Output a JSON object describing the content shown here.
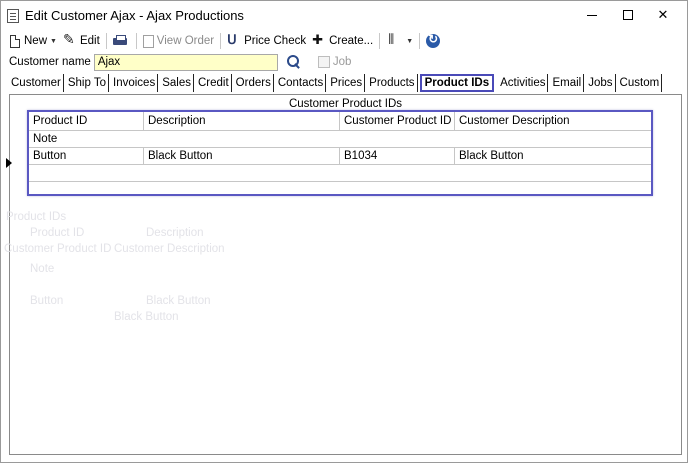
{
  "window": {
    "title": "Edit Customer Ajax - Ajax Productions"
  },
  "titlebar_buttons": {
    "close_glyph": "✕"
  },
  "toolbar": {
    "new_label": "New",
    "edit_label": "Edit",
    "view_order_label": "View Order",
    "price_check_label": "Price Check",
    "create_label": "Create..."
  },
  "customer": {
    "name_label": "Customer name",
    "name_value": "Ajax",
    "job_label": "Job"
  },
  "tabs": [
    {
      "label": "Customer"
    },
    {
      "label": "Ship To"
    },
    {
      "label": "Invoices"
    },
    {
      "label": "Sales"
    },
    {
      "label": "Credit"
    },
    {
      "label": "Orders"
    },
    {
      "label": "Contacts"
    },
    {
      "label": "Prices"
    },
    {
      "label": "Products"
    },
    {
      "label": "Product IDs",
      "active": true
    },
    {
      "label": "Activities"
    },
    {
      "label": "Email"
    },
    {
      "label": "Jobs"
    },
    {
      "label": "Custom"
    }
  ],
  "panel": {
    "title": "Customer Product IDs"
  },
  "grid": {
    "columns": [
      "Product ID",
      "Description",
      "Customer Product ID",
      "Customer Description"
    ],
    "note_label": "Note",
    "rows": [
      {
        "product_id": "Button",
        "description": "Black Button",
        "customer_product_id": "B1034",
        "customer_description": "Black Button"
      }
    ]
  },
  "ghost_text": {
    "product_ids": "Product IDs",
    "product_id": "Product ID",
    "description": "Description",
    "customer_product_id": "Customer Product ID",
    "customer_description": "Customer Description",
    "note": "Note",
    "button": "Button",
    "black_button": "Black Button",
    "black_button_2": "Black Button"
  }
}
